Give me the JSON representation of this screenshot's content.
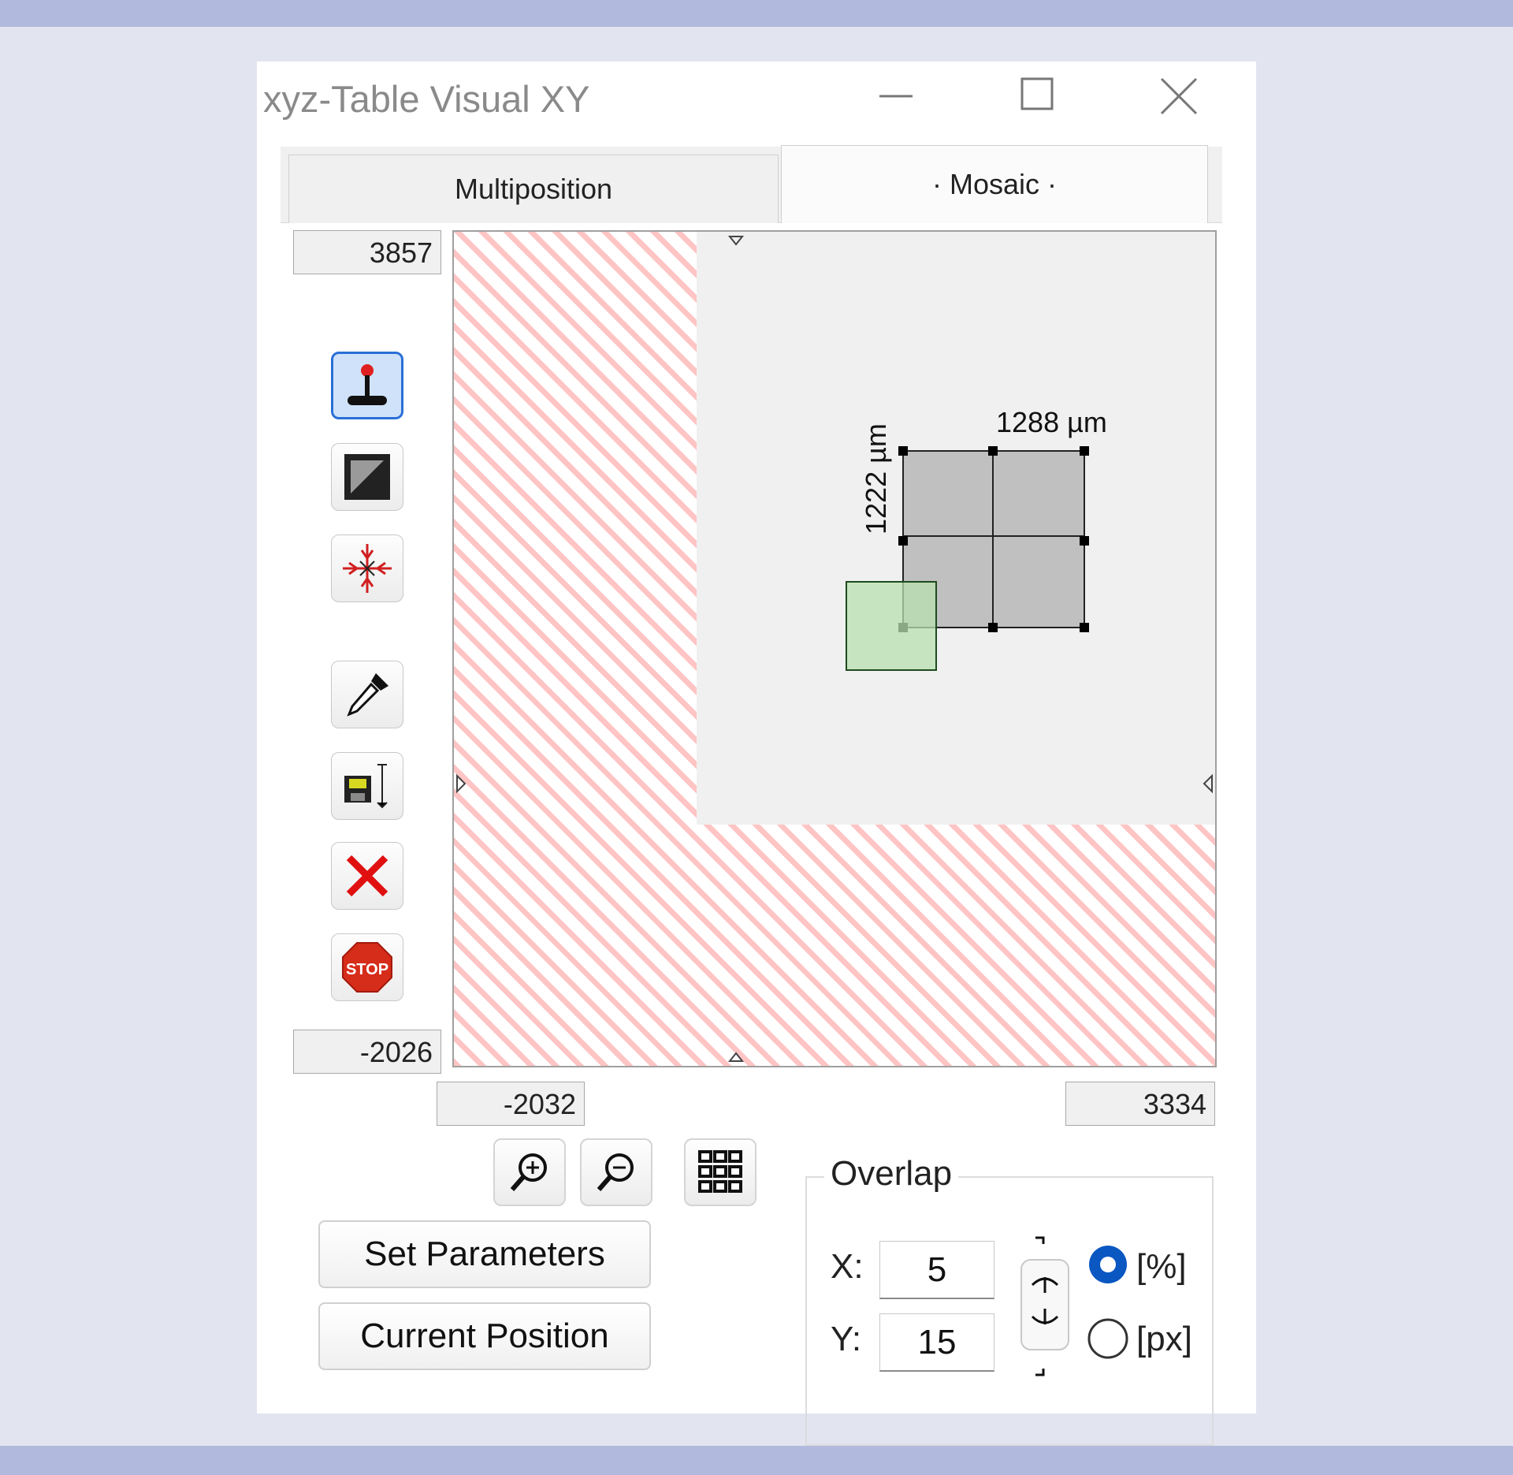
{
  "window": {
    "title": "xyz-Table Visual XY"
  },
  "tabs": {
    "multiposition": "Multiposition",
    "mosaic": "· Mosaic ·"
  },
  "coords": {
    "y_max": "3857",
    "y_min": "-2026",
    "x_min": "-2032",
    "x_max": "3334"
  },
  "canvas": {
    "width_label": "1288 µm",
    "height_label": "1222 µm"
  },
  "tools": [
    "joystick-icon",
    "contrast-icon",
    "center-target-icon",
    "eyedropper-icon",
    "save-position-icon",
    "delete-icon",
    "stop-icon"
  ],
  "buttons": {
    "set_parameters": "Set Parameters",
    "current_position": "Current Position"
  },
  "overlap": {
    "label": "Overlap",
    "x_label": "X:",
    "x_value": "5",
    "y_label": "Y:",
    "y_value": "15",
    "unit_percent": "[%]",
    "unit_px": "[px]",
    "selected_unit": "[%]"
  },
  "colors": {
    "tile_fill": "#c0c0c0",
    "current_fov": "#b8e0b0",
    "limit_stripe": "#ffc4c4",
    "accent": "#0a57c2"
  }
}
